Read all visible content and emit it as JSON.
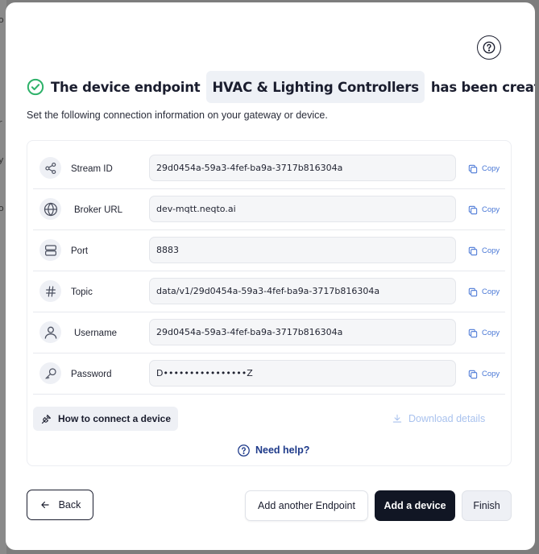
{
  "background": {
    "glimpse_chars": [
      "o",
      "r",
      "y",
      "o"
    ]
  },
  "header": {
    "help_icon": "question-circle-icon",
    "check_icon": "check-circle-icon",
    "title_prefix": "The device endpoint",
    "endpoint_name": "HVAC & Lighting Controllers",
    "title_suffix": "has been created!",
    "subtitle": "Set the following connection information on your gateway or device."
  },
  "fields": [
    {
      "icon": "share-icon",
      "label": "Stream ID",
      "value": "29d0454a-59a3-4fef-ba9a-3717b816304a",
      "copy_label": "Copy"
    },
    {
      "icon": "globe-icon",
      "label": "Broker URL",
      "value": "dev-mqtt.neqto.ai",
      "copy_label": "Copy"
    },
    {
      "icon": "server-icon",
      "label": "Port",
      "value": "8883",
      "copy_label": "Copy"
    },
    {
      "icon": "hash-icon",
      "label": "Topic",
      "value": "data/v1/29d0454a-59a3-4fef-ba9a-3717b816304a",
      "copy_label": "Copy"
    },
    {
      "icon": "user-icon",
      "label": "Username",
      "value": "29d0454a-59a3-4fef-ba9a-3717b816304a",
      "copy_label": "Copy"
    },
    {
      "icon": "key-icon",
      "label": "Password",
      "value": "D••••••••••••••••Z",
      "copy_label": "Copy"
    }
  ],
  "actions": {
    "how_to_connect": "How to connect a device",
    "download_details": "Download details",
    "need_help": "Need help?"
  },
  "footer": {
    "back": "Back",
    "add_endpoint": "Add another Endpoint",
    "add_device": "Add a device",
    "finish": "Finish"
  },
  "colors": {
    "accent_blue": "#4a78d6",
    "success_green": "#2fb26a",
    "primary_dark": "#111624",
    "chip_bg": "#eef1f6"
  }
}
